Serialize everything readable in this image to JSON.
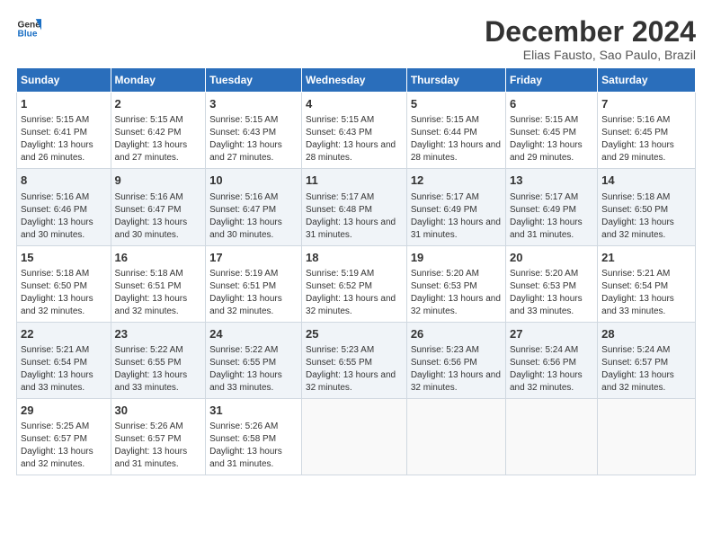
{
  "logo": {
    "line1": "General",
    "line2": "Blue"
  },
  "title": "December 2024",
  "subtitle": "Elias Fausto, Sao Paulo, Brazil",
  "days_of_week": [
    "Sunday",
    "Monday",
    "Tuesday",
    "Wednesday",
    "Thursday",
    "Friday",
    "Saturday"
  ],
  "weeks": [
    [
      {
        "day": 1,
        "sunrise": "5:15 AM",
        "sunset": "6:41 PM",
        "daylight": "13 hours and 26 minutes."
      },
      {
        "day": 2,
        "sunrise": "5:15 AM",
        "sunset": "6:42 PM",
        "daylight": "13 hours and 27 minutes."
      },
      {
        "day": 3,
        "sunrise": "5:15 AM",
        "sunset": "6:43 PM",
        "daylight": "13 hours and 27 minutes."
      },
      {
        "day": 4,
        "sunrise": "5:15 AM",
        "sunset": "6:43 PM",
        "daylight": "13 hours and 28 minutes."
      },
      {
        "day": 5,
        "sunrise": "5:15 AM",
        "sunset": "6:44 PM",
        "daylight": "13 hours and 28 minutes."
      },
      {
        "day": 6,
        "sunrise": "5:15 AM",
        "sunset": "6:45 PM",
        "daylight": "13 hours and 29 minutes."
      },
      {
        "day": 7,
        "sunrise": "5:16 AM",
        "sunset": "6:45 PM",
        "daylight": "13 hours and 29 minutes."
      }
    ],
    [
      {
        "day": 8,
        "sunrise": "5:16 AM",
        "sunset": "6:46 PM",
        "daylight": "13 hours and 30 minutes."
      },
      {
        "day": 9,
        "sunrise": "5:16 AM",
        "sunset": "6:47 PM",
        "daylight": "13 hours and 30 minutes."
      },
      {
        "day": 10,
        "sunrise": "5:16 AM",
        "sunset": "6:47 PM",
        "daylight": "13 hours and 30 minutes."
      },
      {
        "day": 11,
        "sunrise": "5:17 AM",
        "sunset": "6:48 PM",
        "daylight": "13 hours and 31 minutes."
      },
      {
        "day": 12,
        "sunrise": "5:17 AM",
        "sunset": "6:49 PM",
        "daylight": "13 hours and 31 minutes."
      },
      {
        "day": 13,
        "sunrise": "5:17 AM",
        "sunset": "6:49 PM",
        "daylight": "13 hours and 31 minutes."
      },
      {
        "day": 14,
        "sunrise": "5:18 AM",
        "sunset": "6:50 PM",
        "daylight": "13 hours and 32 minutes."
      }
    ],
    [
      {
        "day": 15,
        "sunrise": "5:18 AM",
        "sunset": "6:50 PM",
        "daylight": "13 hours and 32 minutes."
      },
      {
        "day": 16,
        "sunrise": "5:18 AM",
        "sunset": "6:51 PM",
        "daylight": "13 hours and 32 minutes."
      },
      {
        "day": 17,
        "sunrise": "5:19 AM",
        "sunset": "6:51 PM",
        "daylight": "13 hours and 32 minutes."
      },
      {
        "day": 18,
        "sunrise": "5:19 AM",
        "sunset": "6:52 PM",
        "daylight": "13 hours and 32 minutes."
      },
      {
        "day": 19,
        "sunrise": "5:20 AM",
        "sunset": "6:53 PM",
        "daylight": "13 hours and 32 minutes."
      },
      {
        "day": 20,
        "sunrise": "5:20 AM",
        "sunset": "6:53 PM",
        "daylight": "13 hours and 33 minutes."
      },
      {
        "day": 21,
        "sunrise": "5:21 AM",
        "sunset": "6:54 PM",
        "daylight": "13 hours and 33 minutes."
      }
    ],
    [
      {
        "day": 22,
        "sunrise": "5:21 AM",
        "sunset": "6:54 PM",
        "daylight": "13 hours and 33 minutes."
      },
      {
        "day": 23,
        "sunrise": "5:22 AM",
        "sunset": "6:55 PM",
        "daylight": "13 hours and 33 minutes."
      },
      {
        "day": 24,
        "sunrise": "5:22 AM",
        "sunset": "6:55 PM",
        "daylight": "13 hours and 33 minutes."
      },
      {
        "day": 25,
        "sunrise": "5:23 AM",
        "sunset": "6:55 PM",
        "daylight": "13 hours and 32 minutes."
      },
      {
        "day": 26,
        "sunrise": "5:23 AM",
        "sunset": "6:56 PM",
        "daylight": "13 hours and 32 minutes."
      },
      {
        "day": 27,
        "sunrise": "5:24 AM",
        "sunset": "6:56 PM",
        "daylight": "13 hours and 32 minutes."
      },
      {
        "day": 28,
        "sunrise": "5:24 AM",
        "sunset": "6:57 PM",
        "daylight": "13 hours and 32 minutes."
      }
    ],
    [
      {
        "day": 29,
        "sunrise": "5:25 AM",
        "sunset": "6:57 PM",
        "daylight": "13 hours and 32 minutes."
      },
      {
        "day": 30,
        "sunrise": "5:26 AM",
        "sunset": "6:57 PM",
        "daylight": "13 hours and 31 minutes."
      },
      {
        "day": 31,
        "sunrise": "5:26 AM",
        "sunset": "6:58 PM",
        "daylight": "13 hours and 31 minutes."
      },
      null,
      null,
      null,
      null
    ]
  ]
}
